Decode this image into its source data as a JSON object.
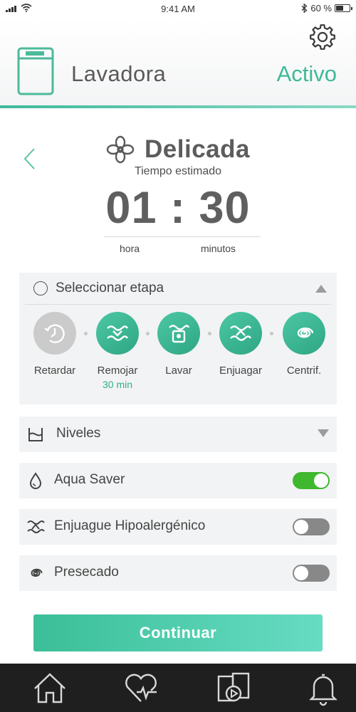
{
  "status_bar": {
    "time": "9:41 AM",
    "battery_text": "60 %",
    "battery_level": 0.6
  },
  "header": {
    "device_name": "Lavadora",
    "device_status": "Activo"
  },
  "program": {
    "name": "Delicada",
    "time_label": "Tiempo estimado",
    "timer": "01 : 30",
    "unit_hours": "hora",
    "unit_minutes": "minutos"
  },
  "stage_panel": {
    "title": "Seleccionar etapa",
    "steps": [
      {
        "label": "Retardar",
        "sub": "",
        "active": false,
        "icon": "delay-clock-icon"
      },
      {
        "label": "Remojar",
        "sub": "30 min",
        "active": true,
        "icon": "soak-icon"
      },
      {
        "label": "Lavar",
        "sub": "",
        "active": true,
        "icon": "wash-icon"
      },
      {
        "label": "Enjuagar",
        "sub": "",
        "active": true,
        "icon": "rinse-icon"
      },
      {
        "label": "Centrif.",
        "sub": "",
        "active": true,
        "icon": "spin-icon"
      }
    ]
  },
  "options": {
    "levels": {
      "label": "Niveles",
      "icon": "water-level-icon"
    },
    "aqua_saver": {
      "label": "Aqua Saver",
      "enabled": true,
      "icon": "water-drop-icon"
    },
    "hypo_rinse": {
      "label": "Enjuague Hipoalergénico",
      "enabled": false,
      "icon": "rinse-wave-icon"
    },
    "predry": {
      "label": "Presecado",
      "enabled": false,
      "icon": "spiral-icon"
    }
  },
  "continue_label": "Continuar",
  "tab_bar": {
    "items": [
      "home-icon",
      "health-heart-icon",
      "video-icon",
      "bell-icon"
    ]
  },
  "colors": {
    "accent": "#3fb997",
    "toggle_on": "#3fb72e",
    "toggle_off": "#888888",
    "tab_bar": "#1f1f1f"
  }
}
